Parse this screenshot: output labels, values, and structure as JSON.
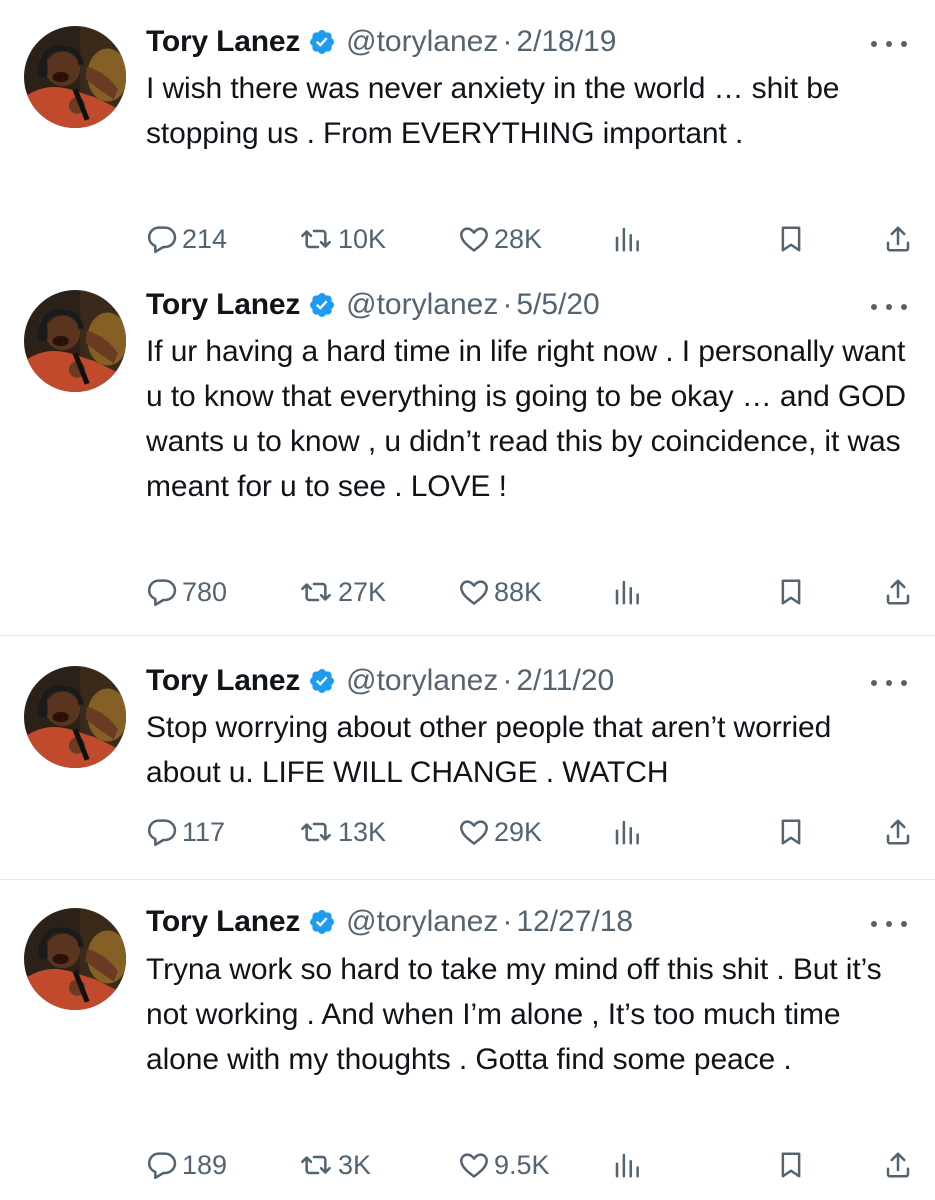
{
  "colors": {
    "verified": "#1d9bf0",
    "text": "#0f1419",
    "secondary": "#536471"
  },
  "tweets": [
    {
      "name": "Tory Lanez",
      "handle": "@torylanez",
      "separator": "·",
      "date": "2/18/19",
      "text": "I wish there was never anxiety in the world … shit be stopping us . From EVERYTHING important .",
      "replies": "214",
      "retweets": "10K",
      "likes": "28K"
    },
    {
      "name": "Tory Lanez",
      "handle": "@torylanez",
      "separator": "·",
      "date": "5/5/20",
      "text": "If ur having a hard time in life right now . I personally want u to know that everything is going to be okay … and GOD wants u to know , u didn’t read this by coincidence, it was meant for u to see . LOVE !",
      "replies": "780",
      "retweets": "27K",
      "likes": "88K"
    },
    {
      "name": "Tory Lanez",
      "handle": "@torylanez",
      "separator": "·",
      "date": "2/11/20",
      "text": "Stop worrying about other people that aren’t worried about u. LIFE WILL CHANGE . WATCH",
      "replies": "117",
      "retweets": "13K",
      "likes": "29K"
    },
    {
      "name": "Tory Lanez",
      "handle": "@torylanez",
      "separator": "·",
      "date": "12/27/18",
      "text": "Tryna work so hard to take my mind off this shit . But it’s not working . And when I’m alone , It’s too much time alone with my thoughts . Gotta find some peace .",
      "replies": "189",
      "retweets": "3K",
      "likes": "9.5K"
    }
  ]
}
